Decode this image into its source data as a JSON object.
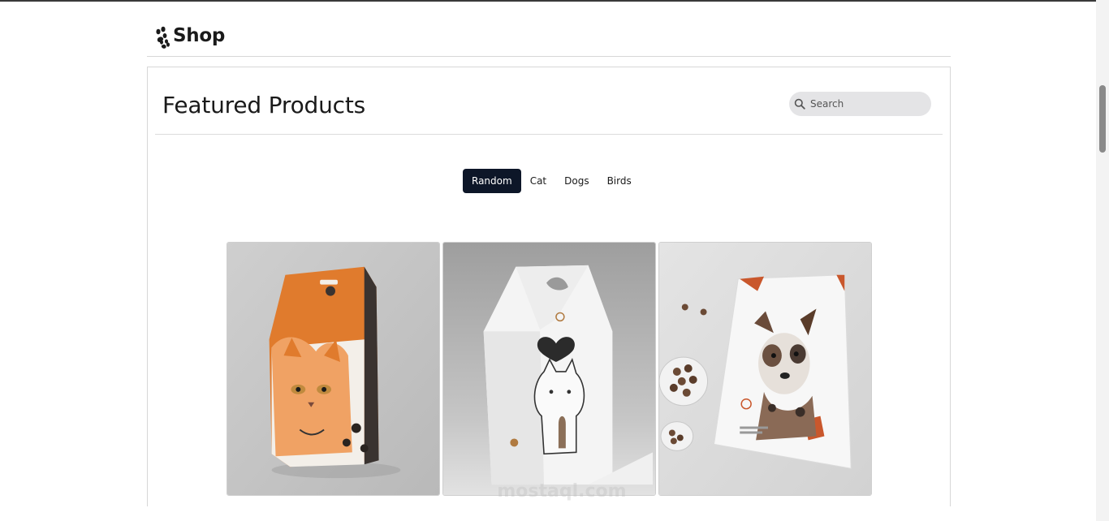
{
  "header": {
    "brand": "Shop",
    "logo_icon": "paw-icon"
  },
  "main": {
    "title": "Featured Products",
    "search": {
      "placeholder": "Search",
      "value": ""
    },
    "tabs": [
      {
        "label": "Random",
        "active": true
      },
      {
        "label": "Cat",
        "active": false
      },
      {
        "label": "Dogs",
        "active": false
      },
      {
        "label": "Birds",
        "active": false
      }
    ],
    "products": [
      {
        "image": "cat-food-bag-orange"
      },
      {
        "image": "white-cat-box"
      },
      {
        "image": "dog-food-pouch"
      }
    ]
  },
  "watermark": {
    "text": "mostaql.com"
  },
  "colors": {
    "active_tab_bg": "#0d1628",
    "search_bg": "#e4e4e6",
    "border": "#d7d7d7"
  }
}
